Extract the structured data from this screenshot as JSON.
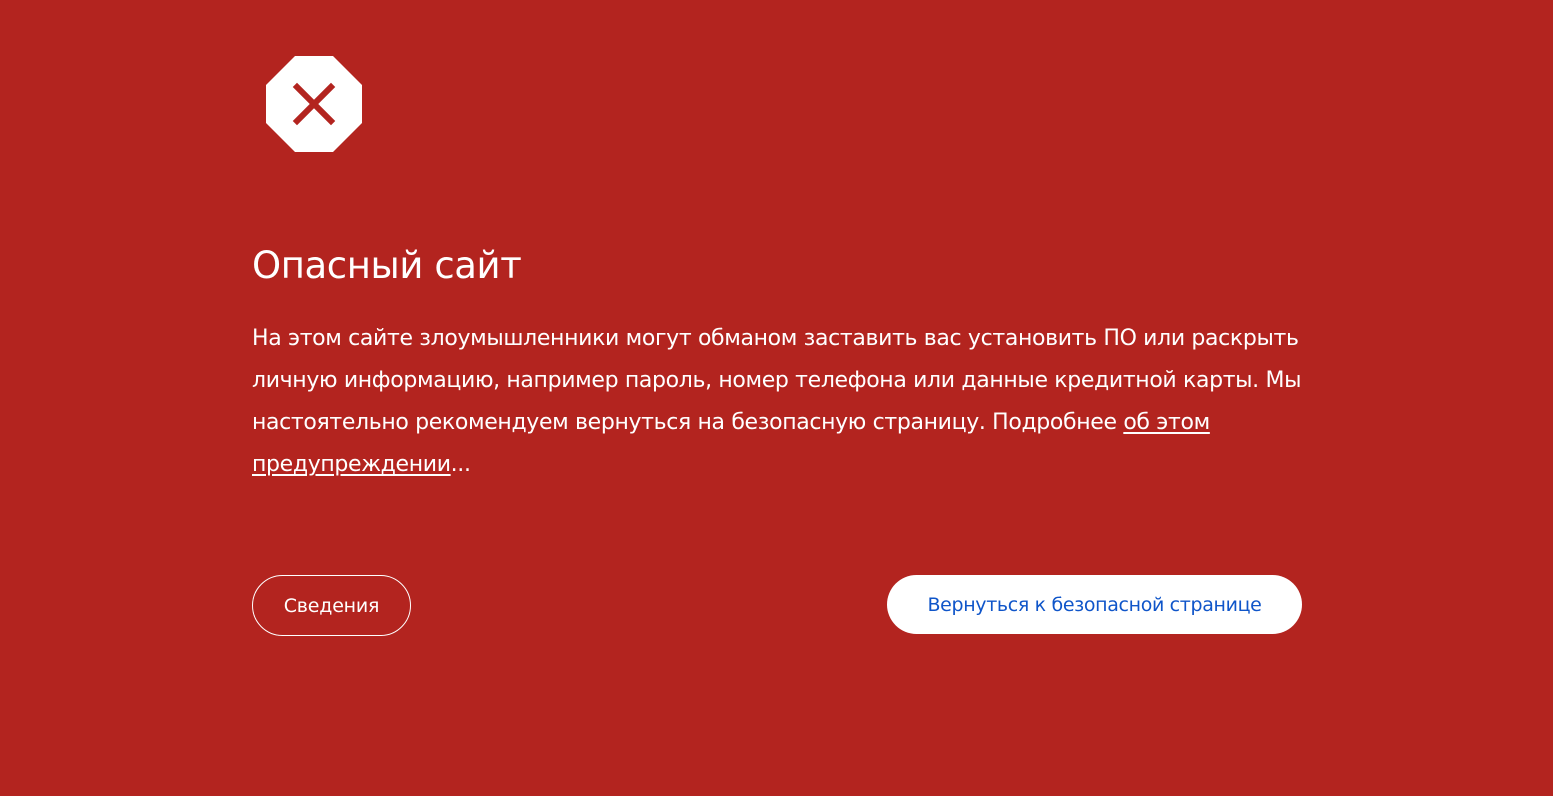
{
  "colors": {
    "background": "#b3241f",
    "text": "#ffffff",
    "primary_button_background": "#ffffff",
    "primary_button_text": "#0f55c9"
  },
  "icon": {
    "name": "unsafe-site-stop-icon"
  },
  "title": "Опасный сайт",
  "message": {
    "text": "На этом сайте злоумышленники могут обманом заставить вас установить ПО или раскрыть личную информацию, например пароль, номер телефона или данные кредитной карты. Мы настоятельно рекомендуем вернуться на безопасную страницу. Подробнее ",
    "link_text": "об этом предупреждении",
    "suffix": "..."
  },
  "buttons": {
    "details_label": "Сведения",
    "back_label": "Вернуться к безопасной странице"
  }
}
